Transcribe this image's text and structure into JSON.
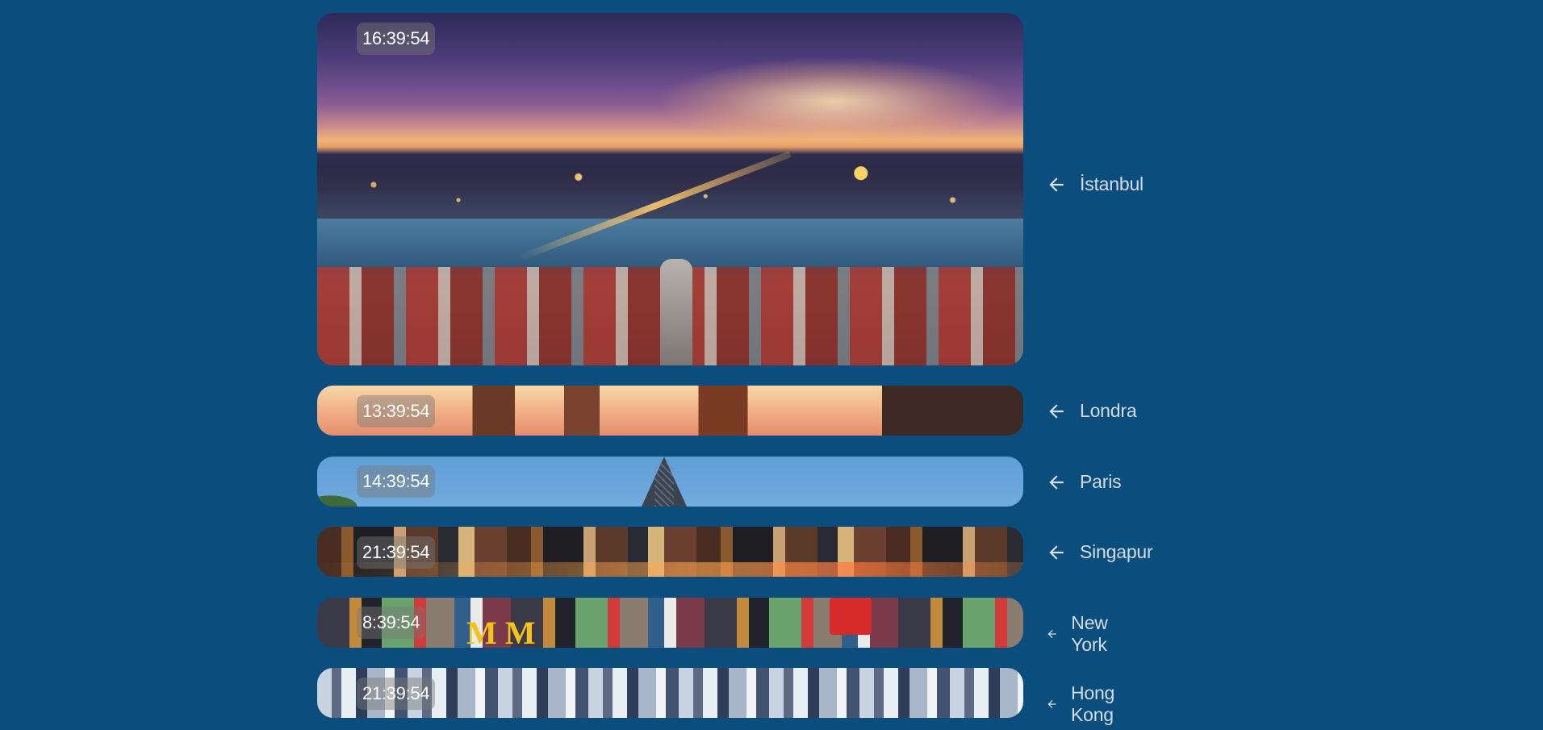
{
  "cities": [
    {
      "name": "İstanbul",
      "time": "16:39:54"
    },
    {
      "name": "Londra",
      "time": "13:39:54"
    },
    {
      "name": "Paris",
      "time": "14:39:54"
    },
    {
      "name": "Singapur",
      "time": "21:39:54"
    },
    {
      "name": "New York",
      "time": "8:39:54"
    },
    {
      "name": "Hong Kong",
      "time": "21:39:54"
    }
  ],
  "newyork_sign": "M M",
  "icons": {
    "row_arrow": "arrow-left-icon"
  },
  "colors": {
    "background": "#0b4d7d",
    "label_text": "#d3dde8",
    "clock_text": "#ffffff"
  }
}
